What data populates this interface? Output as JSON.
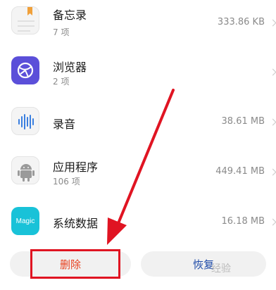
{
  "apps": [
    {
      "name": "备忘录",
      "count": "7 项",
      "size": "333.86 KB"
    },
    {
      "name": "浏览器",
      "count": "2 项",
      "size": ""
    },
    {
      "name": "录音",
      "count": "",
      "size": "38.61 MB"
    },
    {
      "name": "应用程序",
      "count": "106 项",
      "size": "449.41 MB"
    },
    {
      "name": "系统数据",
      "count": "",
      "size": "16.18 MB",
      "icon_text": "Magic"
    }
  ],
  "actions": {
    "delete_label": "删除",
    "restore_label": "恢复"
  },
  "watermark": "经验",
  "colors": {
    "delete_text": "#e8401f",
    "restore_text": "#1f4ba8",
    "annotation_red": "#e01422",
    "browser_icon": "#5b4fd9",
    "magic_icon": "#19c2d8"
  }
}
